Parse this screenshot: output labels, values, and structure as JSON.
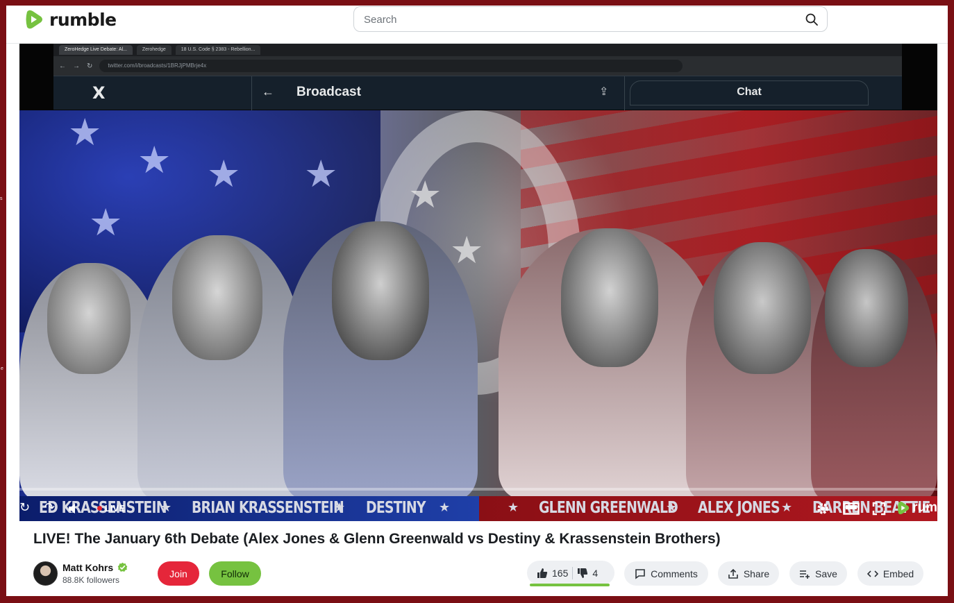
{
  "header": {
    "logo_text": "rumble",
    "search_placeholder": "Search"
  },
  "player": {
    "browser_tabs": [
      "ZeroHedge Live Debate: Al...",
      "Zerohedge",
      "18 U.S. Code § 2383 - Rebellion..."
    ],
    "browser_url": "twitter.com/i/broadcasts/1BRJjPMBrje4x",
    "x_logo": "X",
    "x_back": "←",
    "x_title": "Broadcast",
    "x_share": "⇪",
    "x_chat": "Chat",
    "name_bar": {
      "left": [
        "ED KRASSENSTEIN",
        "BRIAN KRASSENSTEIN",
        "DESTINY"
      ],
      "right": [
        "GLENN GREENWALD",
        "ALEX JONES",
        "DARREN BEATTIE"
      ]
    },
    "live_label": "LIVE",
    "player_logo_text": "rum"
  },
  "video": {
    "title": "LIVE! The January 6th Debate (Alex Jones & Glenn Greenwald vs Destiny & Krassenstein Brothers)"
  },
  "channel": {
    "name": "Matt Kohrs",
    "followers": "88.8K followers",
    "join_label": "Join",
    "follow_label": "Follow"
  },
  "actions": {
    "likes": "165",
    "dislikes": "4",
    "like_ratio": 0.976,
    "comments_label": "Comments",
    "share_label": "Share",
    "save_label": "Save",
    "embed_label": "Embed"
  },
  "colors": {
    "page_border": "#7a0f14",
    "brand_green": "#76c240",
    "join_red": "#e5263a"
  }
}
